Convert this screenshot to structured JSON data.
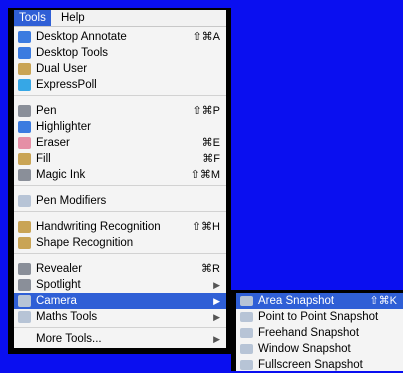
{
  "menubar": {
    "tools": "Tools",
    "help": "Help"
  },
  "tools_menu": {
    "groups": [
      [
        {
          "icon": "desktop-annotate-icon",
          "label": "Desktop Annotate",
          "shortcut": "⇧⌘A"
        },
        {
          "icon": "desktop-tools-icon",
          "label": "Desktop Tools",
          "shortcut": ""
        },
        {
          "icon": "dual-user-icon",
          "label": "Dual User",
          "shortcut": ""
        },
        {
          "icon": "expresspoll-icon",
          "label": "ExpressPoll",
          "shortcut": ""
        }
      ],
      [
        {
          "icon": "pen-icon",
          "label": "Pen",
          "shortcut": "⇧⌘P"
        },
        {
          "icon": "highlighter-icon",
          "label": "Highlighter",
          "shortcut": ""
        },
        {
          "icon": "eraser-icon",
          "label": "Eraser",
          "shortcut": "⌘E"
        },
        {
          "icon": "fill-icon",
          "label": "Fill",
          "shortcut": "⌘F"
        },
        {
          "icon": "magic-ink-icon",
          "label": "Magic Ink",
          "shortcut": "⇧⌘M"
        }
      ],
      [
        {
          "icon": "pen-modifiers-icon",
          "label": "Pen Modifiers",
          "shortcut": ""
        }
      ],
      [
        {
          "icon": "handwriting-recognition-icon",
          "label": "Handwriting Recognition",
          "shortcut": "⇧⌘H"
        },
        {
          "icon": "shape-recognition-icon",
          "label": "Shape Recognition",
          "shortcut": ""
        }
      ],
      [
        {
          "icon": "revealer-icon",
          "label": "Revealer",
          "shortcut": "⌘R"
        },
        {
          "icon": "spotlight-icon",
          "label": "Spotlight",
          "shortcut": "",
          "submenu": true
        },
        {
          "icon": "camera-icon",
          "label": "Camera",
          "shortcut": "",
          "submenu": true,
          "highlighted": true
        },
        {
          "icon": "maths-tools-icon",
          "label": "Maths Tools",
          "shortcut": "",
          "submenu": true
        }
      ],
      [
        {
          "icon": "",
          "label": "More Tools...",
          "shortcut": "",
          "submenu": true
        }
      ]
    ]
  },
  "camera_submenu": [
    {
      "icon": "area-snapshot-icon",
      "label": "Area Snapshot",
      "shortcut": "⇧⌘K",
      "highlighted": true
    },
    {
      "icon": "point-snapshot-icon",
      "label": "Point to Point Snapshot",
      "shortcut": ""
    },
    {
      "icon": "freehand-snapshot-icon",
      "label": "Freehand Snapshot",
      "shortcut": ""
    },
    {
      "icon": "window-snapshot-icon",
      "label": "Window Snapshot",
      "shortcut": ""
    },
    {
      "icon": "fullscreen-snapshot-icon",
      "label": "Fullscreen Snapshot",
      "shortcut": ""
    }
  ],
  "colors": {
    "background": "#0a0ff0",
    "highlight": "#2f5fd6",
    "menu_bg": "#f4f4f4"
  }
}
